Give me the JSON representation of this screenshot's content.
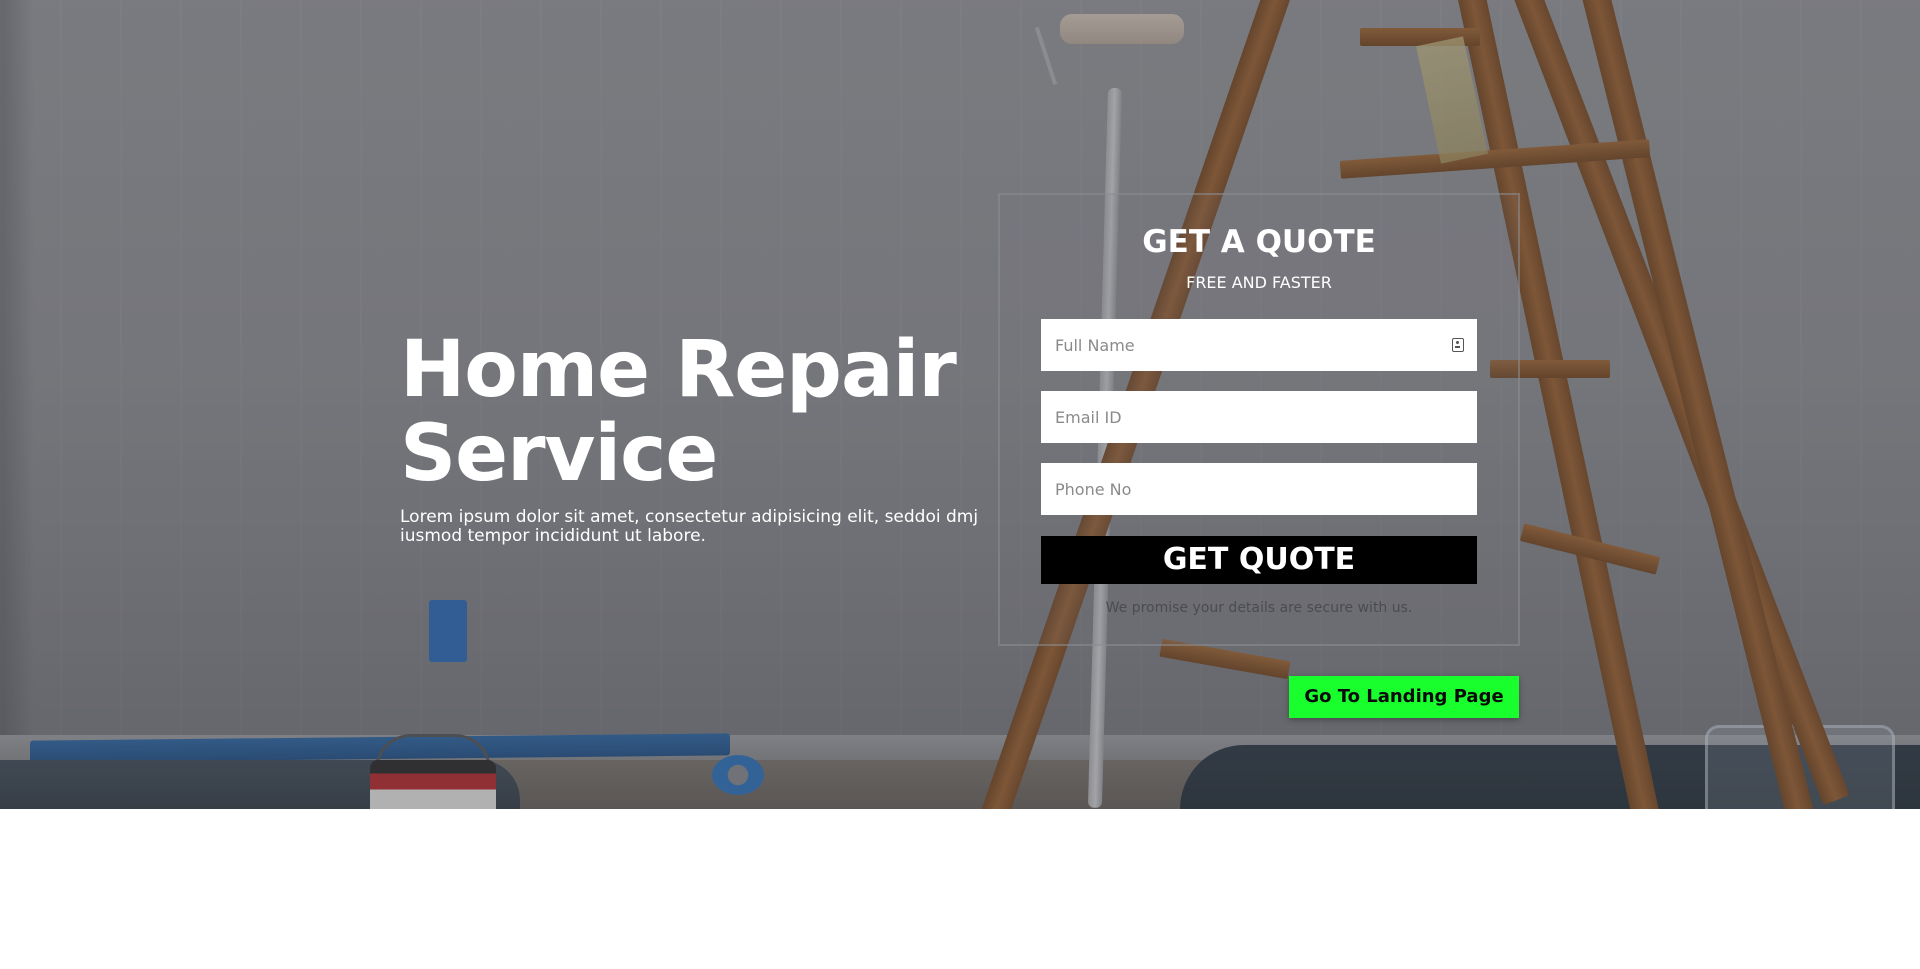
{
  "hero": {
    "title": "Home Repair Service",
    "description": "Lorem ipsum dolor sit amet, consectetur adipisicing elit, seddoi dmj iusmod tempor incididunt ut labore."
  },
  "quote_form": {
    "title": "GET A QUOTE",
    "subtitle": "FREE AND FASTER",
    "full_name_placeholder": "Full Name",
    "full_name_value": "",
    "email_placeholder": "Email ID",
    "email_value": "",
    "phone_placeholder": "Phone No",
    "phone_value": "",
    "submit_label": "GET QUOTE",
    "secure_note": "We promise your details are secure with us."
  },
  "landing_button": {
    "label": "Go To Landing Page"
  },
  "colors": {
    "submit_background": "#000000",
    "landing_button_background": "#19ff2e",
    "heading_text": "#ffffff"
  },
  "icons": {
    "full_name_field_icon": "contact-card-icon"
  }
}
